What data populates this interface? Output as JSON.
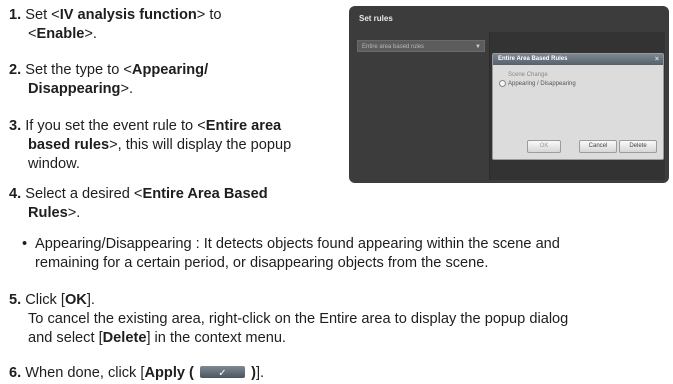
{
  "steps": {
    "s1": {
      "num": "1.",
      "pre": " Set <",
      "b1": "IV analysis function",
      "mid": "> to",
      "pre2": "<",
      "b2": "Enable",
      "post": ">."
    },
    "s2": {
      "num": "2.",
      "pre": " Set the type to <",
      "b1": "Appearing/",
      "b2": "Disappearing",
      "post": ">."
    },
    "s3": {
      "num": "3.",
      "pre": " If you set the event rule to <",
      "b1": "Entire area",
      "b2": "based rules",
      "post": ">, this will display the popup",
      "post2": "window."
    },
    "s4": {
      "num": "4.",
      "pre": " Select a desired <",
      "b1": "Entire Area Based",
      "b2": "Rules",
      "post": ">."
    },
    "bullet": {
      "dot": "•",
      "text": "Appearing/Disappearing : It detects objects found appearing within the scene and",
      "text2": "remaining for a certain period, or disappearing objects from the scene."
    },
    "s5": {
      "num": "5.",
      "pre": " Click [",
      "b1": "OK",
      "post": "].",
      "line2": "To cancel the existing area, right-click on the Entire area to display the popup dialog",
      "line3pre": "and select [",
      "b2": "Delete",
      "line3post": "] in the context menu."
    },
    "s6": {
      "num": "6.",
      "pre": " When done, click [",
      "b1": "Apply (",
      "b2": ")",
      "post": "].",
      "btn": "✓"
    }
  },
  "screenshot": {
    "title": "Set rules",
    "rule_select": "Entire area based rules",
    "popup": {
      "title": "Entire Area Based Rules",
      "close": "×",
      "opt1": "Scene Change",
      "opt2": "Appearing / Disappearing",
      "ok": "OK",
      "cancel": "Cancel",
      "delete": "Delete"
    }
  }
}
